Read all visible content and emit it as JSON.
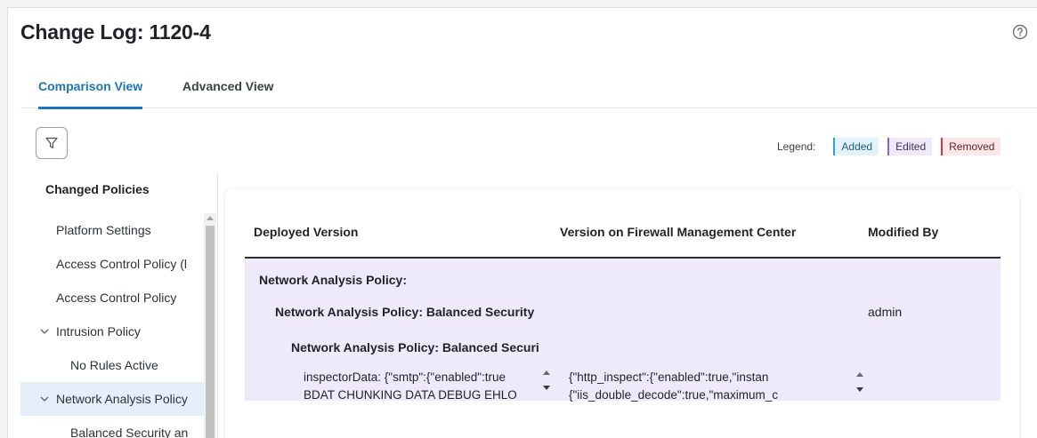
{
  "page": {
    "title": "Change Log: 1120-4",
    "help_icon": "help-circle-icon"
  },
  "tabs": [
    {
      "label": "Comparison View",
      "active": true
    },
    {
      "label": "Advanced View",
      "active": false
    }
  ],
  "filter": {
    "icon": "filter-icon"
  },
  "legend": {
    "label": "Legend:",
    "items": [
      {
        "label": "Added",
        "color": "#2ba3d9"
      },
      {
        "label": "Edited",
        "color": "#8a63d2"
      },
      {
        "label": "Removed",
        "color": "#d9363e"
      }
    ]
  },
  "sidebar": {
    "title": "Changed Policies",
    "items": [
      {
        "label": "Platform Settings",
        "indent": 0,
        "expandable": false
      },
      {
        "label": "Access Control Policy (l",
        "indent": 0,
        "expandable": false
      },
      {
        "label": "Access Control Policy",
        "indent": 0,
        "expandable": false
      },
      {
        "label": "Intrusion Policy",
        "indent": 0,
        "expandable": true,
        "expanded": true
      },
      {
        "label": "No Rules Active",
        "indent": 1,
        "expandable": false
      },
      {
        "label": "Network Analysis Policy",
        "indent": 0,
        "expandable": true,
        "expanded": true,
        "selected": true
      },
      {
        "label": "Balanced Security an",
        "indent": 1,
        "expandable": false
      }
    ]
  },
  "table": {
    "headers": {
      "deployed": "Deployed Version",
      "fmc": "Version on Firewall Management Center",
      "modified": "Modified By"
    },
    "level1": "Network Analysis Policy:",
    "level2": "Network Analysis Policy: Balanced Security",
    "level2_modified_by": "admin",
    "level3": "Network Analysis Policy: Balanced Securi",
    "deployed_lines": [
      "inspectorData: {\"smtp\":{\"enabled\":true",
      "BDAT CHUNKING DATA DEBUG EHLO"
    ],
    "fmc_lines": [
      "{\"http_inspect\":{\"enabled\":true,\"instan",
      "{\"iis_double_decode\":true,\"maximum_c"
    ]
  }
}
